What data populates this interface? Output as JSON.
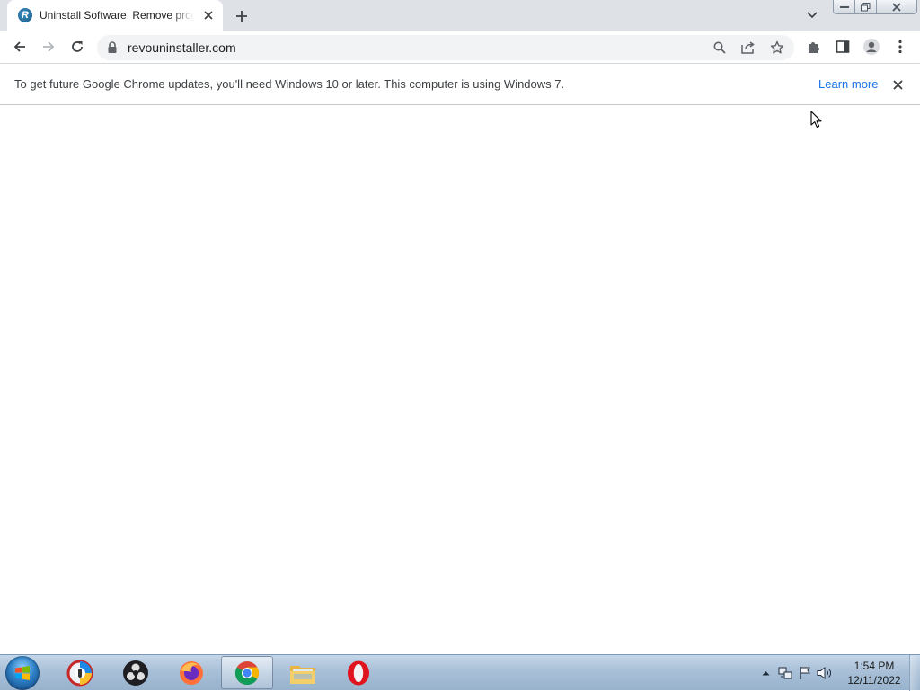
{
  "browser": {
    "tab": {
      "title": "Uninstall Software, Remove programs",
      "favicon_letter": "R"
    },
    "address_bar": {
      "url": "revouninstaller.com"
    },
    "infobar": {
      "message": "To get future Google Chrome updates, you'll need Windows 10 or later. This computer is using Windows 7.",
      "link_label": "Learn more"
    }
  },
  "taskbar": {
    "apps": [
      {
        "name": "Start"
      },
      {
        "name": "Revo Uninstaller"
      },
      {
        "name": "OBS Studio"
      },
      {
        "name": "Firefox"
      },
      {
        "name": "Google Chrome",
        "active": true
      },
      {
        "name": "File Explorer"
      },
      {
        "name": "Opera"
      }
    ],
    "clock": {
      "time": "1:54 PM",
      "date": "12/11/2022"
    }
  },
  "colors": {
    "tab_strip": "#dee1e6",
    "omnibox": "#f1f3f4",
    "link": "#1a73e8",
    "taskbar": "#a9c0d8"
  }
}
